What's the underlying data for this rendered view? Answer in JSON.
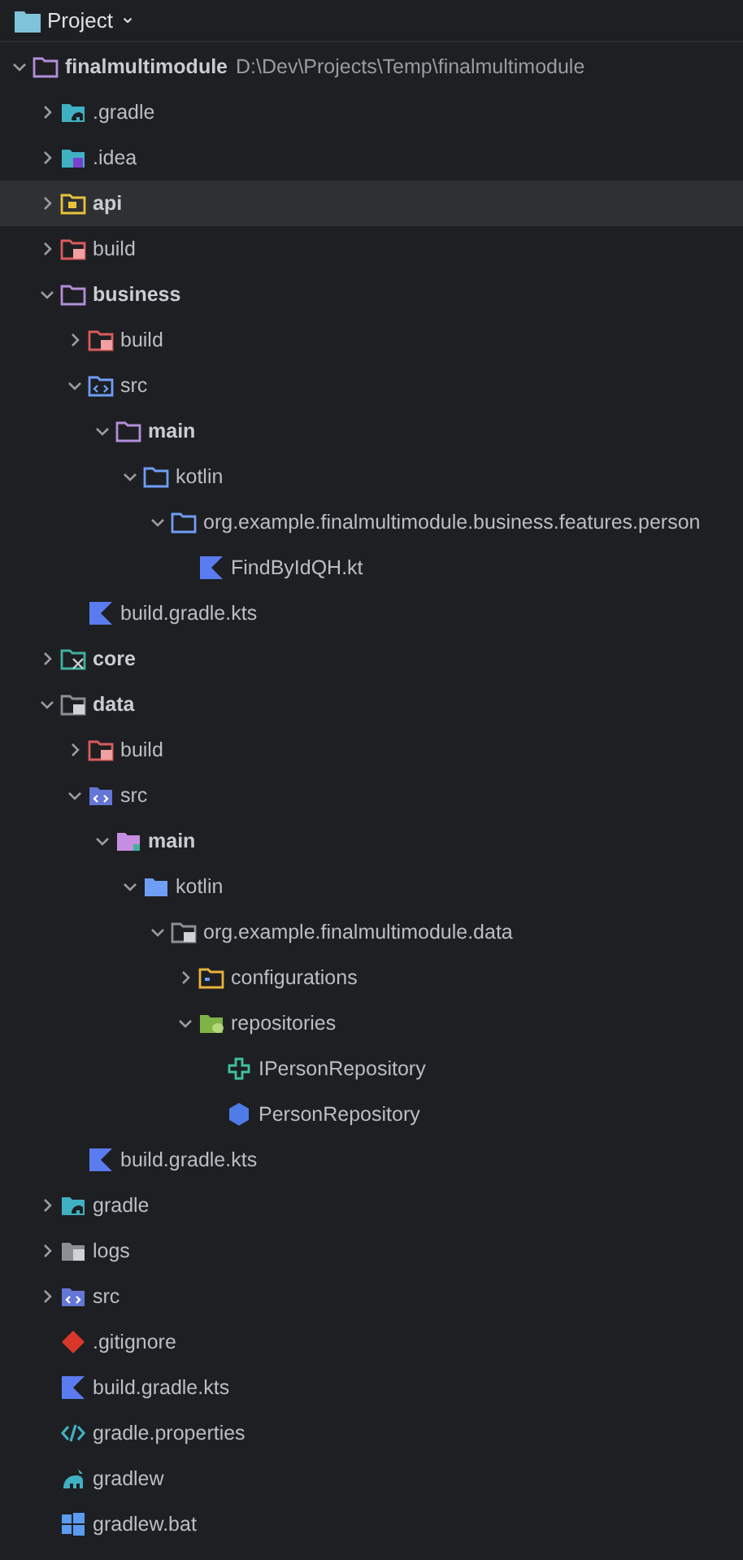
{
  "header": {
    "title": "Project",
    "caret": "⌄"
  },
  "tree": [
    {
      "name": "finalmultimodule",
      "path": "D:\\Dev\\Projects\\Temp\\finalmultimodule",
      "kind": "module",
      "bold": true,
      "expanded": true,
      "selected": false,
      "children": [
        {
          "name": ".gradle",
          "kind": "gradle-folder",
          "bold": false,
          "expanded": false,
          "selected": false
        },
        {
          "name": ".idea",
          "kind": "idea-folder",
          "bold": false,
          "expanded": false,
          "selected": false
        },
        {
          "name": "api",
          "kind": "api-folder",
          "bold": true,
          "expanded": false,
          "selected": true
        },
        {
          "name": "build",
          "kind": "excluded-folder",
          "bold": false,
          "expanded": false,
          "selected": false
        },
        {
          "name": "business",
          "kind": "module",
          "bold": true,
          "expanded": true,
          "selected": false,
          "children": [
            {
              "name": "build",
              "kind": "excluded-folder",
              "bold": false,
              "expanded": false,
              "selected": false
            },
            {
              "name": "src",
              "kind": "source-folder",
              "bold": false,
              "expanded": true,
              "selected": false,
              "children": [
                {
                  "name": "main",
                  "kind": "module",
                  "bold": true,
                  "expanded": true,
                  "selected": false,
                  "children": [
                    {
                      "name": "kotlin",
                      "kind": "folder",
                      "bold": false,
                      "expanded": true,
                      "selected": false,
                      "children": [
                        {
                          "name": "org.example.finalmultimodule.business.features.person",
                          "kind": "folder",
                          "bold": false,
                          "expanded": true,
                          "selected": false,
                          "children": [
                            {
                              "name": "FindByIdQH.kt",
                              "kind": "kotlin-file",
                              "bold": false,
                              "selected": false
                            }
                          ]
                        }
                      ]
                    }
                  ]
                }
              ]
            },
            {
              "name": "build.gradle.kts",
              "kind": "kotlin-file",
              "bold": false,
              "selected": false
            }
          ]
        },
        {
          "name": "core",
          "kind": "test-folder",
          "bold": true,
          "expanded": false,
          "selected": false
        },
        {
          "name": "data",
          "kind": "locked-folder",
          "bold": true,
          "expanded": true,
          "selected": false,
          "children": [
            {
              "name": "build",
              "kind": "excluded-folder",
              "bold": false,
              "expanded": false,
              "selected": false
            },
            {
              "name": "src",
              "kind": "source-filled-folder",
              "bold": false,
              "expanded": true,
              "selected": false,
              "children": [
                {
                  "name": "main",
                  "kind": "main-folder",
                  "bold": true,
                  "expanded": true,
                  "selected": false,
                  "children": [
                    {
                      "name": "kotlin",
                      "kind": "filled-folder",
                      "bold": false,
                      "expanded": true,
                      "selected": false,
                      "children": [
                        {
                          "name": "org.example.finalmultimodule.data",
                          "kind": "locked-folder",
                          "bold": false,
                          "expanded": true,
                          "selected": false,
                          "children": [
                            {
                              "name": "configurations",
                              "kind": "config-folder",
                              "bold": false,
                              "expanded": false,
                              "selected": false
                            },
                            {
                              "name": "repositories",
                              "kind": "db-folder",
                              "bold": false,
                              "expanded": true,
                              "selected": false,
                              "children": [
                                {
                                  "name": "IPersonRepository",
                                  "kind": "interface",
                                  "bold": false,
                                  "selected": false
                                },
                                {
                                  "name": "PersonRepository",
                                  "kind": "class",
                                  "bold": false,
                                  "selected": false
                                }
                              ]
                            }
                          ]
                        }
                      ]
                    }
                  ]
                }
              ]
            },
            {
              "name": "build.gradle.kts",
              "kind": "kotlin-file",
              "bold": false,
              "selected": false
            }
          ]
        },
        {
          "name": "gradle",
          "kind": "gradle-folder",
          "bold": false,
          "expanded": false,
          "selected": false
        },
        {
          "name": "logs",
          "kind": "text-folder",
          "bold": false,
          "expanded": false,
          "selected": false
        },
        {
          "name": "src",
          "kind": "source-filled-folder",
          "bold": false,
          "expanded": false,
          "selected": false
        },
        {
          "name": ".gitignore",
          "kind": "git-file",
          "bold": false,
          "selected": false
        },
        {
          "name": "build.gradle.kts",
          "kind": "kotlin-file",
          "bold": false,
          "selected": false
        },
        {
          "name": "gradle.properties",
          "kind": "properties-file",
          "bold": false,
          "selected": false
        },
        {
          "name": "gradlew",
          "kind": "gradle-file",
          "bold": false,
          "selected": false
        },
        {
          "name": "gradlew.bat",
          "kind": "windows-file",
          "bold": false,
          "selected": false
        }
      ]
    }
  ]
}
